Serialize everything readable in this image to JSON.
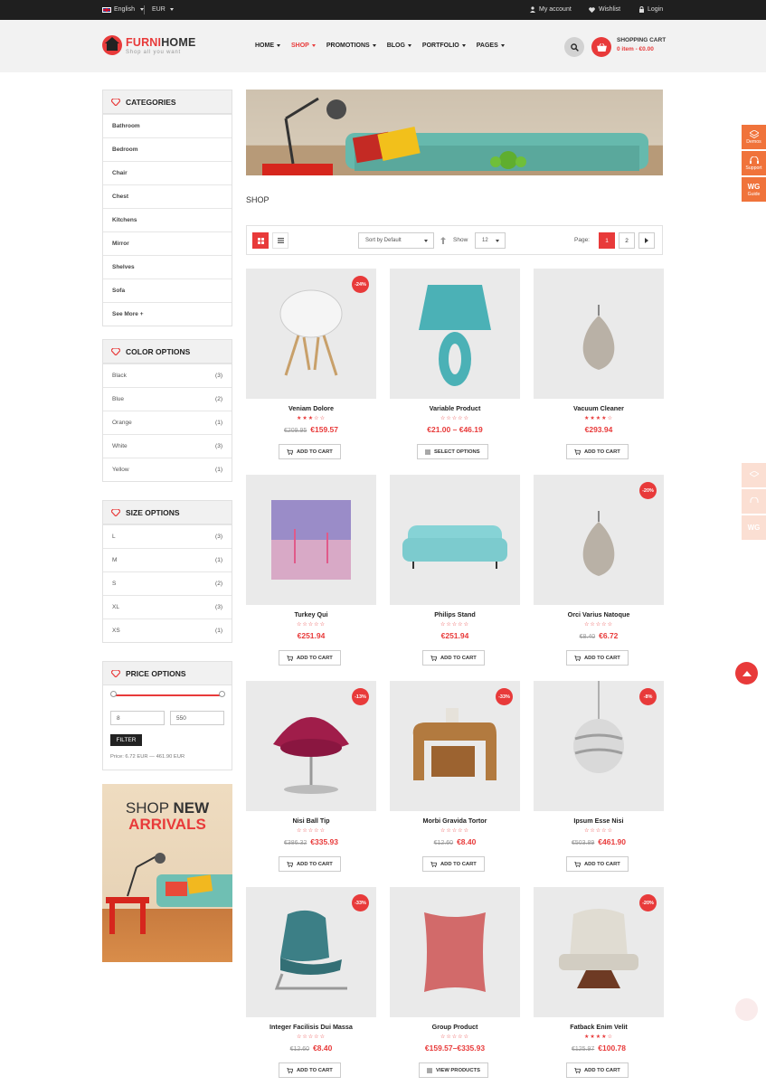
{
  "topbar": {
    "language": "English",
    "currency": "EUR",
    "my_account": "My account",
    "wishlist": "Wishlist",
    "login": "Login"
  },
  "header": {
    "logo_part1": "FURNI",
    "logo_part2": "HOME",
    "tagline": "Shop all you want",
    "nav": [
      "HOME",
      "SHOP",
      "PROMOTIONS",
      "BLOG",
      "PORTFOLIO",
      "PAGES"
    ],
    "active_nav": "SHOP",
    "cart_title": "SHOPPING CART",
    "cart_summary": "0 item - €0.00"
  },
  "sidebar": {
    "categories": {
      "title": "CATEGORIES",
      "items": [
        "Bathroom",
        "Bedroom",
        "Chair",
        "Chest",
        "Kitchens",
        "Mirror",
        "Shelves",
        "Sofa",
        "See More +"
      ]
    },
    "colors": {
      "title": "COLOR OPTIONS",
      "items": [
        {
          "label": "Black",
          "count": "(3)"
        },
        {
          "label": "Blue",
          "count": "(2)"
        },
        {
          "label": "Orange",
          "count": "(1)"
        },
        {
          "label": "White",
          "count": "(3)"
        },
        {
          "label": "Yellow",
          "count": "(1)"
        }
      ]
    },
    "sizes": {
      "title": "SIZE OPTIONS",
      "items": [
        {
          "label": "L",
          "count": "(3)"
        },
        {
          "label": "M",
          "count": "(1)"
        },
        {
          "label": "S",
          "count": "(2)"
        },
        {
          "label": "XL",
          "count": "(3)"
        },
        {
          "label": "XS",
          "count": "(1)"
        }
      ]
    },
    "price": {
      "title": "PRICE OPTIONS",
      "min": "8",
      "max": "550",
      "filter_label": "FILTER",
      "range_text": "Price: 6.72 EUR — 461.90 EUR"
    },
    "promo": {
      "line1a": "SHOP ",
      "line1b": "NEW",
      "line2": "ARRIVALS"
    }
  },
  "main": {
    "heading": "SHOP",
    "toolbar": {
      "sort": "Sort by Default",
      "show_label": "Show",
      "show_value": "12",
      "page_label": "Page:",
      "pages": [
        "1",
        "2"
      ],
      "current_page": "1"
    },
    "products": [
      {
        "name": "Veniam Dolore",
        "rating": "★★★☆☆",
        "old_price": "€209.95",
        "price": "€159.57",
        "badge": "-24%",
        "button": "ADD TO CART"
      },
      {
        "name": "Variable Product",
        "rating": "☆☆☆☆☆",
        "old_price": "",
        "price": "€21.00 – €46.19",
        "badge": "",
        "button": "SELECT OPTIONS"
      },
      {
        "name": "Vacuum Cleaner",
        "rating": "★★★★☆",
        "old_price": "",
        "price": "€293.94",
        "badge": "",
        "button": "ADD TO CART"
      },
      {
        "name": "Turkey Qui",
        "rating": "☆☆☆☆☆",
        "old_price": "",
        "price": "€251.94",
        "badge": "",
        "button": "ADD TO CART"
      },
      {
        "name": "Philips Stand",
        "rating": "☆☆☆☆☆",
        "old_price": "",
        "price": "€251.94",
        "badge": "",
        "button": "ADD TO CART"
      },
      {
        "name": "Orci Varius Natoque",
        "rating": "☆☆☆☆☆",
        "old_price": "€8.40",
        "price": "€6.72",
        "badge": "-20%",
        "button": "ADD TO CART"
      },
      {
        "name": "Nisi Ball Tip",
        "rating": "☆☆☆☆☆",
        "old_price": "€386.32",
        "price": "€335.93",
        "badge": "-13%",
        "button": "ADD TO CART"
      },
      {
        "name": "Morbi Gravida Tortor",
        "rating": "☆☆☆☆☆",
        "old_price": "€12.60",
        "price": "€8.40",
        "badge": "-33%",
        "button": "ADD TO CART"
      },
      {
        "name": "Ipsum Esse Nisi",
        "rating": "☆☆☆☆☆",
        "old_price": "€503.89",
        "price": "€461.90",
        "badge": "-8%",
        "button": "ADD TO CART"
      },
      {
        "name": "Integer Facilisis Dui Massa",
        "rating": "☆☆☆☆☆",
        "old_price": "€12.60",
        "price": "€8.40",
        "badge": "-33%",
        "button": "ADD TO CART"
      },
      {
        "name": "Group Product",
        "rating": "☆☆☆☆☆",
        "old_price": "",
        "price": "€159.57–€335.93",
        "badge": "",
        "button": "VIEW PRODUCTS"
      },
      {
        "name": "Fatback Enim Velit",
        "rating": "★★★★☆",
        "old_price": "€125.97",
        "price": "€100.78",
        "badge": "-20%",
        "button": "ADD TO CART"
      }
    ]
  },
  "side_tabs": [
    "Demos",
    "Support",
    "Guide"
  ],
  "colors": {
    "accent": "#e83a3a",
    "topbar": "#1f1f1f",
    "header_bg": "#f2f2f2",
    "side_tab": "#f0733b"
  }
}
